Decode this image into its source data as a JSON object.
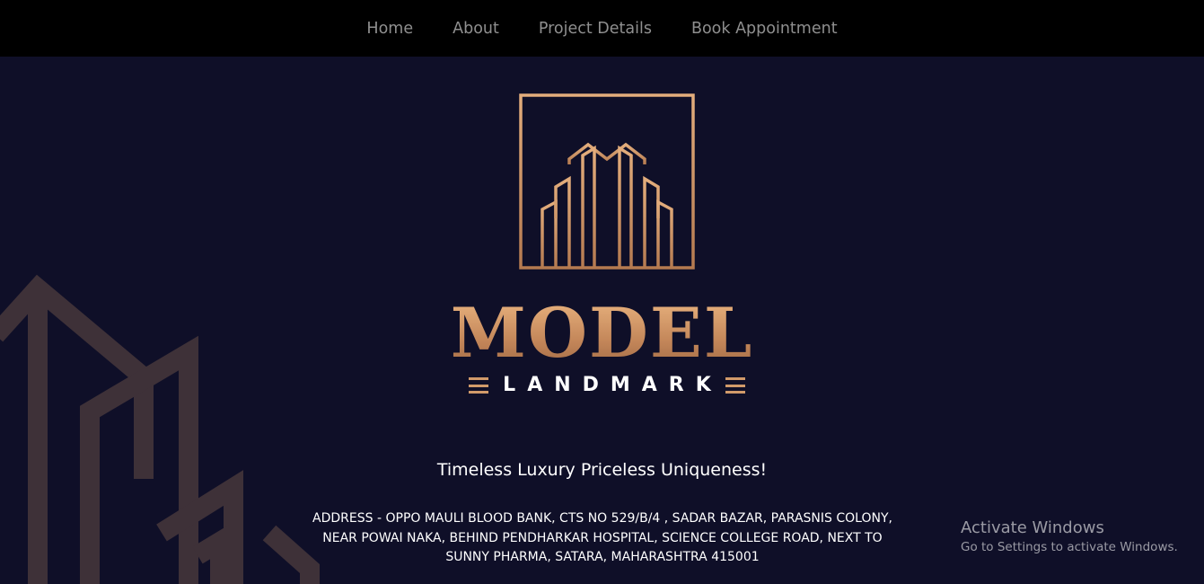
{
  "nav": {
    "items": [
      {
        "label": "Home"
      },
      {
        "label": "About"
      },
      {
        "label": "Project Details"
      },
      {
        "label": "Book Appointment"
      }
    ]
  },
  "hero": {
    "brand_name": "MODEL",
    "brand_sub": "LANDMARK",
    "tagline": "Timeless Luxury Priceless Uniqueness!",
    "address_line1": "ADDRESS - OPPO MAULI BLOOD BANK, CTS NO 529/B/4 , SADAR BAZAR, PARASNIS COLONY,",
    "address_line2": "NEAR POWAI NAKA, BEHIND PENDHARKAR HOSPITAL, SCIENCE COLLEGE ROAD, NEXT TO",
    "address_line3": "SUNNY PHARMA, SATARA, MAHARASHTRA 415001"
  },
  "os_watermark": {
    "title": "Activate Windows",
    "subtitle": "Go to Settings to activate Windows."
  },
  "colors": {
    "nav_bg": "#000000",
    "nav_text": "#8f8f8f",
    "hero_bg": "#0f0f28",
    "gold": "#c98e5f",
    "text": "#ffffff",
    "watermark_text": "#9a9aa4"
  },
  "icons": {
    "logo": "building-logo-icon",
    "background": "building-outline-icon"
  }
}
